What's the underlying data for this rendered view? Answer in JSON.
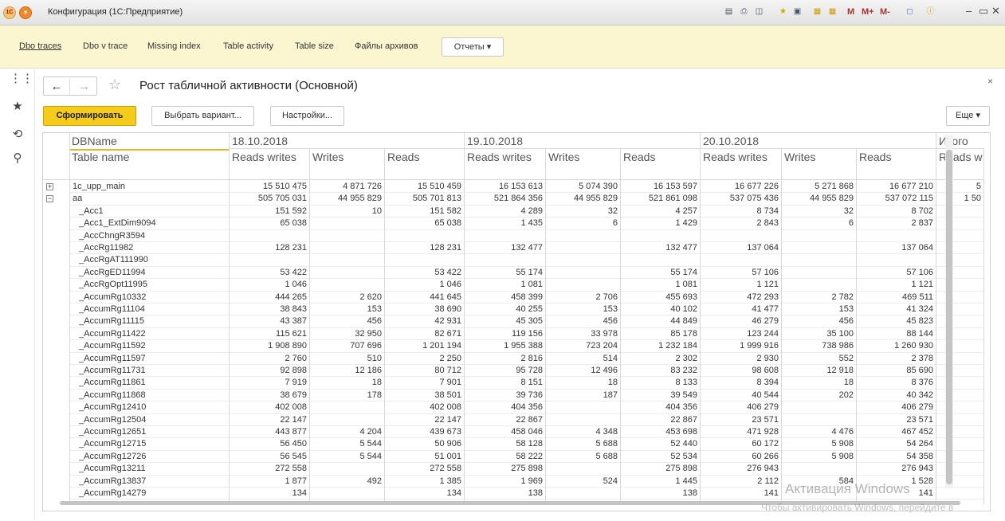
{
  "window": {
    "logo": "1C",
    "title": "Конфигурация (1С:Предприятие)",
    "memory_labels": [
      "M",
      "M+",
      "M-"
    ],
    "icons": [
      "save-icon",
      "print-icon",
      "preview-icon",
      "favorites-icon",
      "history-icon",
      "calculator-icon",
      "calendar-icon",
      "panel-icon",
      "info-icon"
    ]
  },
  "sections": [
    "Dbo traces",
    "Dbo v trace",
    "Missing index",
    "Table activity",
    "Table size",
    "Файлы архивов"
  ],
  "reports_label": "Отчеты",
  "left_panel": [
    "apps-icon",
    "favorites-icon",
    "history-icon",
    "search-icon"
  ],
  "form": {
    "title": "Рост табличной активности (Основной)",
    "generate_label": "Сформировать",
    "variant_label": "Выбрать вариант...",
    "settings_label": "Настройки...",
    "more_label": "Еще"
  },
  "table": {
    "dbname_header": "DBName",
    "tablename_header": "Table name",
    "date_groups": [
      "18.10.2018",
      "19.10.2018",
      "20.10.2018",
      "Итого"
    ],
    "sub_headers": [
      "Reads writes",
      "Writes",
      "Reads",
      "Reads writes",
      "Writes",
      "Reads",
      "Reads writes",
      "Writes",
      "Reads",
      "Reads w"
    ],
    "rows": [
      {
        "name": "1c_upp_main",
        "group": "plus",
        "v": [
          "15 510 475",
          "4 871 726",
          "15 510 459",
          "16 153 613",
          "5 074 390",
          "16 153 597",
          "16 677 226",
          "5 271 868",
          "16 677 210",
          "5"
        ]
      },
      {
        "name": "aa",
        "group": "minus",
        "v": [
          "505 705 031",
          "44 955 829",
          "505 701 813",
          "521 864 356",
          "44 955 829",
          "521 861 098",
          "537 075 436",
          "44 955 829",
          "537 072 115",
          "1 50"
        ]
      },
      {
        "name": "_Acc1",
        "v": [
          "151 592",
          "10",
          "151 582",
          "4 289",
          "32",
          "4 257",
          "8 734",
          "32",
          "8 702",
          ""
        ]
      },
      {
        "name": "_Acc1_ExtDim9094",
        "v": [
          "65 038",
          "",
          "65 038",
          "1 435",
          "6",
          "1 429",
          "2 843",
          "6",
          "2 837",
          ""
        ]
      },
      {
        "name": "_AccChngR3594",
        "v": [
          "",
          "",
          "",
          "",
          "",
          "",
          "",
          "",
          "",
          ""
        ]
      },
      {
        "name": "_AccRg11982",
        "v": [
          "128 231",
          "",
          "128 231",
          "132 477",
          "",
          "132 477",
          "137 064",
          "",
          "137 064",
          ""
        ]
      },
      {
        "name": "_AccRgAT111990",
        "v": [
          "",
          "",
          "",
          "",
          "",
          "",
          "",
          "",
          "",
          ""
        ]
      },
      {
        "name": "_AccRgED11994",
        "v": [
          "53 422",
          "",
          "53 422",
          "55 174",
          "",
          "55 174",
          "57 106",
          "",
          "57 106",
          ""
        ]
      },
      {
        "name": "_AccRgOpt11995",
        "v": [
          "1 046",
          "",
          "1 046",
          "1 081",
          "",
          "1 081",
          "1 121",
          "",
          "1 121",
          ""
        ]
      },
      {
        "name": "_AccumRg10332",
        "v": [
          "444 265",
          "2 620",
          "441 645",
          "458 399",
          "2 706",
          "455 693",
          "472 293",
          "2 782",
          "469 511",
          ""
        ]
      },
      {
        "name": "_AccumRg11104",
        "v": [
          "38 843",
          "153",
          "38 690",
          "40 255",
          "153",
          "40 102",
          "41 477",
          "153",
          "41 324",
          ""
        ]
      },
      {
        "name": "_AccumRg11115",
        "v": [
          "43 387",
          "456",
          "42 931",
          "45 305",
          "456",
          "44 849",
          "46 279",
          "456",
          "45 823",
          ""
        ]
      },
      {
        "name": "_AccumRg11422",
        "v": [
          "115 621",
          "32 950",
          "82 671",
          "119 156",
          "33 978",
          "85 178",
          "123 244",
          "35 100",
          "88 144",
          ""
        ]
      },
      {
        "name": "_AccumRg11592",
        "v": [
          "1 908 890",
          "707 696",
          "1 201 194",
          "1 955 388",
          "723 204",
          "1 232 184",
          "1 999 916",
          "738 986",
          "1 260 930",
          ""
        ]
      },
      {
        "name": "_AccumRg11597",
        "v": [
          "2 760",
          "510",
          "2 250",
          "2 816",
          "514",
          "2 302",
          "2 930",
          "552",
          "2 378",
          ""
        ]
      },
      {
        "name": "_AccumRg11731",
        "v": [
          "92 898",
          "12 186",
          "80 712",
          "95 728",
          "12 496",
          "83 232",
          "98 608",
          "12 918",
          "85 690",
          ""
        ]
      },
      {
        "name": "_AccumRg11861",
        "v": [
          "7 919",
          "18",
          "7 901",
          "8 151",
          "18",
          "8 133",
          "8 394",
          "18",
          "8 376",
          ""
        ]
      },
      {
        "name": "_AccumRg11868",
        "v": [
          "38 679",
          "178",
          "38 501",
          "39 736",
          "187",
          "39 549",
          "40 544",
          "202",
          "40 342",
          ""
        ]
      },
      {
        "name": "_AccumRg12410",
        "v": [
          "402 008",
          "",
          "402 008",
          "404 356",
          "",
          "404 356",
          "406 279",
          "",
          "406 279",
          ""
        ]
      },
      {
        "name": "_AccumRg12504",
        "v": [
          "22 147",
          "",
          "22 147",
          "22 867",
          "",
          "22 867",
          "23 571",
          "",
          "23 571",
          ""
        ]
      },
      {
        "name": "_AccumRg12651",
        "v": [
          "443 877",
          "4 204",
          "439 673",
          "458 046",
          "4 348",
          "453 698",
          "471 928",
          "4 476",
          "467 452",
          ""
        ]
      },
      {
        "name": "_AccumRg12715",
        "v": [
          "56 450",
          "5 544",
          "50 906",
          "58 128",
          "5 688",
          "52 440",
          "60 172",
          "5 908",
          "54 264",
          ""
        ]
      },
      {
        "name": "_AccumRg12726",
        "v": [
          "56 545",
          "5 544",
          "51 001",
          "58 222",
          "5 688",
          "52 534",
          "60 266",
          "5 908",
          "54 358",
          ""
        ]
      },
      {
        "name": "_AccumRg13211",
        "v": [
          "272 558",
          "",
          "272 558",
          "275 898",
          "",
          "275 898",
          "276 943",
          "",
          "276 943",
          ""
        ]
      },
      {
        "name": "_AccumRg13837",
        "v": [
          "1 877",
          "492",
          "1 385",
          "1 969",
          "524",
          "1 445",
          "2 112",
          "584",
          "1 528",
          ""
        ]
      },
      {
        "name": "_AccumRg14279",
        "v": [
          "134",
          "",
          "134",
          "138",
          "",
          "138",
          "141",
          "",
          "141",
          ""
        ]
      }
    ]
  },
  "watermark": {
    "line1": "Активация Windows",
    "line2": "Чтобы активировать Windows, перейдите в"
  }
}
